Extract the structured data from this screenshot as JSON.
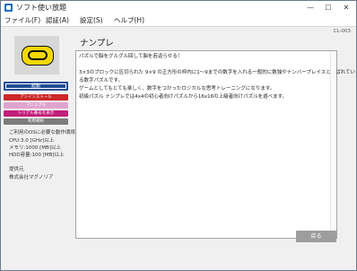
{
  "window": {
    "title": "ソフト使い放題",
    "minimize": "—",
    "maximize": "☐",
    "close": "✕"
  },
  "menu": [
    "ファイル(F)",
    "認証(A)",
    "設定(S)",
    "ヘルプ(H)"
  ],
  "page_code": "CL-003",
  "sidebar": {
    "logo_icon": "nampre-logo",
    "buttons": {
      "start": "起動",
      "uninstall": "アンインストール",
      "manual": "マニュアル",
      "serial": "シリアル番号を表示",
      "terms": "利用規約"
    },
    "requirements": {
      "heading": "ご利用のOSに必要な動作環境",
      "cpu": "CPU:3.0 [GHz]以上",
      "memory": "メモリ:1000 [MB]以上",
      "hdd": "HDD容量:100 [MB]以上"
    },
    "provider_label": "提供元",
    "provider_name": "株式会社マグノリア"
  },
  "main": {
    "heading": "ナンプレ",
    "description": [
      "パズルで脳をグルグル回して脳を若返らせる！",
      "3×3のブロックに区切られた 9×9 の正方形の枠内に1～9までの数字を入れる一般的に数独やナンバープレイスと呼ばれてい",
      "る数字パズルです。",
      "ゲームとしてもとても楽しく、数字をつかったロジカルな思考トレーニングになります。",
      "初級パズル ナンプレでは4x4の初心者向けパズルから16x16の上級者向けパズルを遊べます。"
    ],
    "back_button": "戻る"
  }
}
